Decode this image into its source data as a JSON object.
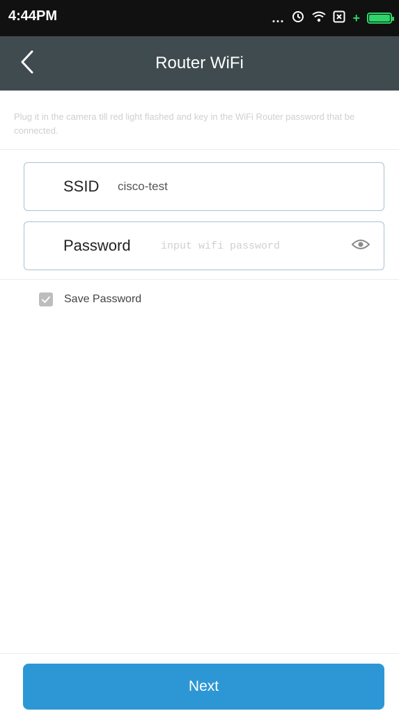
{
  "status_bar": {
    "time": "4:44PM",
    "dots": "...",
    "icons": [
      "clock-icon",
      "wifi-icon",
      "sim-icon",
      "battery-icon"
    ],
    "battery_color": "#2fd36a"
  },
  "app_bar": {
    "title": "Router WiFi",
    "back_icon": "chevron-left-icon",
    "background": "#3f4b4f"
  },
  "hint": "Plug it in the camera till red light flashed and key in the WiFi Router password that be connected.",
  "form": {
    "ssid_label": "SSID",
    "ssid_value": "cisco-test",
    "password_label": "Password",
    "password_placeholder": "input wifi password",
    "password_value": "",
    "eye_icon": "eye-icon",
    "save_password_label": "Save Password",
    "save_password_checked": true
  },
  "footer": {
    "next_label": "Next",
    "button_color": "#2d97d5"
  }
}
